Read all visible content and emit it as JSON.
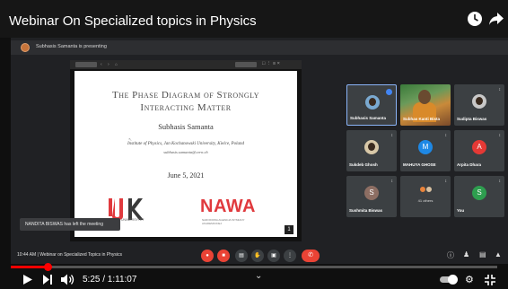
{
  "video": {
    "title": "Webinar On Specialized topics in Physics"
  },
  "meet": {
    "presenting_text": "Subhasis Samanta is presenting",
    "toast_text": "NANDITA BISWAS has left the meeting",
    "time_text": "10:44 AM  |  Webinar on Specialized Topics in Physics",
    "participants": [
      {
        "name": "Subhasis Samanta",
        "type": "photo",
        "speaking": true
      },
      {
        "name": "Subhas Kanti Bista",
        "type": "video",
        "speaking": false
      },
      {
        "name": "Sudipta Biswas",
        "type": "photo-dark",
        "speaking": false
      },
      {
        "name": "Sukdeb Ghosh",
        "type": "photo",
        "speaking": false
      },
      {
        "name": "MAHUYA GHOSE",
        "initial": "M",
        "color": "#1e88e5"
      },
      {
        "name": "Arpita Dhara",
        "initial": "A",
        "color": "#e53935"
      },
      {
        "name": "Sushmita Biswas",
        "initial": "S",
        "color": "#8d6e63"
      },
      {
        "name": "41 others",
        "type": "others"
      },
      {
        "name": "You",
        "initial": "S",
        "color": "#2e9e4f"
      }
    ],
    "control_icons": [
      "mic-off-icon",
      "camera-off-icon",
      "captions-icon",
      "raise-hand-icon",
      "present-icon",
      "more-icon",
      "hang-up-icon"
    ]
  },
  "slide": {
    "title_line1": "The Phase Diagram of Strongly",
    "title_line2": "Interacting Matter",
    "author": "Subhasis Samanta",
    "affiliation": "Institute of Physics, Jan Kochanowski University, Kielce, Poland",
    "email": "subhasis.samanta@cern.ch",
    "date": "June 5, 2021",
    "uj_logo_text": "UJK",
    "uj_sub": "UNIWERSYTET",
    "nawa_logo_text": "NAWA",
    "nawa_sub": "NARODOWA AGENCJA WYMIANY AKADEMICKIEJ",
    "slide_number": "1"
  },
  "player": {
    "current_time": "5:25",
    "duration": "1:11:07",
    "time_display": "5:25 / 1:11:07",
    "progress_fraction": 0.076
  },
  "colors": {
    "youtube_red": "#ff0000",
    "meet_red": "#ea4335",
    "nawa_red": "#e03a3e"
  }
}
